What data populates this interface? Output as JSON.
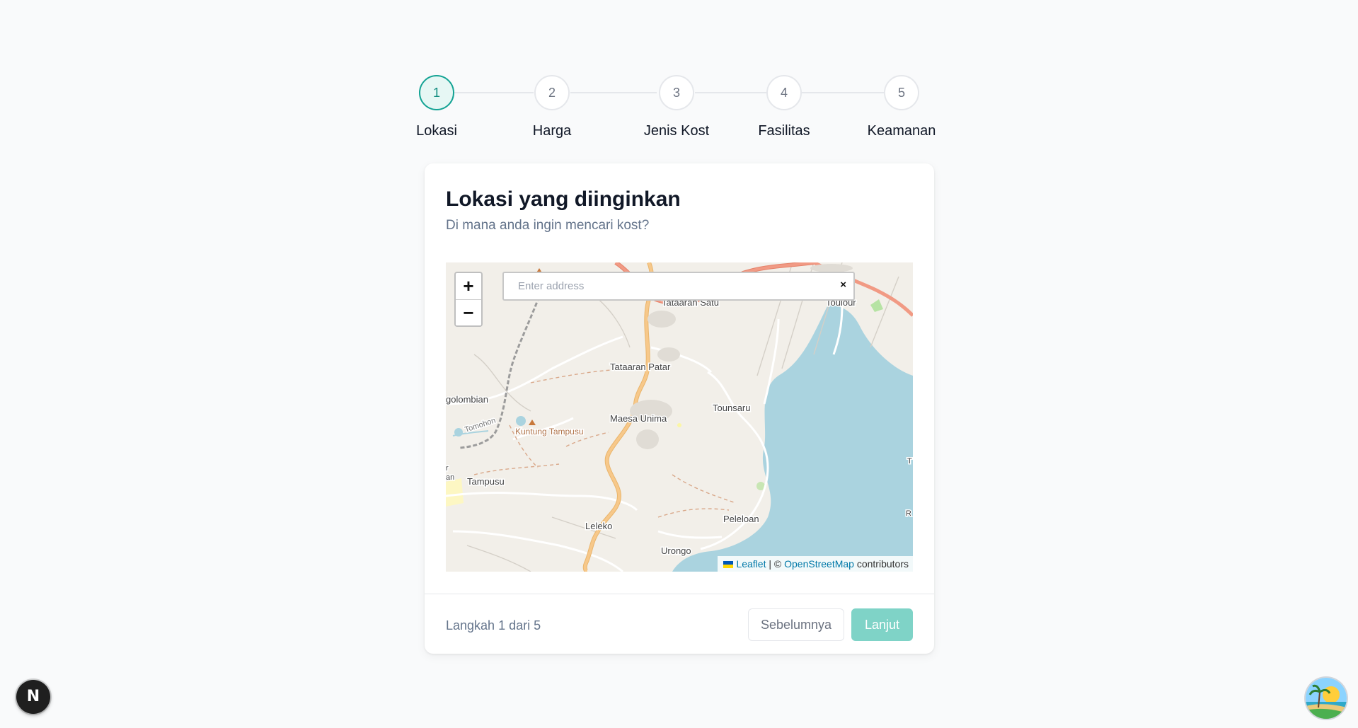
{
  "stepper": {
    "steps": [
      {
        "number": "1",
        "label": "Lokasi",
        "active": true
      },
      {
        "number": "2",
        "label": "Harga",
        "active": false
      },
      {
        "number": "3",
        "label": "Jenis Kost",
        "active": false
      },
      {
        "number": "4",
        "label": "Fasilitas",
        "active": false
      },
      {
        "number": "5",
        "label": "Keamanan",
        "active": false
      }
    ]
  },
  "card": {
    "title": "Lokasi yang diinginkan",
    "subtitle": "Di mana anda ingin mencari kost?"
  },
  "map": {
    "zoom_in": "+",
    "zoom_out": "−",
    "search_placeholder": "Enter address",
    "search_value": "",
    "clear": "×",
    "places": [
      "Tataaran Satu",
      "Toulour",
      "Tataaran Patar",
      "golombian",
      "Tomohon",
      "Kuntung Tampusu",
      "Maesa Unima",
      "Tounsaru",
      "Tampusu",
      "an",
      "r",
      "Leleko",
      "Peleloan",
      "Urongo",
      "T",
      "R"
    ],
    "attribution": {
      "leaflet": "Leaflet",
      "separator": " | © ",
      "osm": "OpenStreetMap",
      "suffix": " contributors"
    }
  },
  "footer": {
    "step_counter": "Langkah 1 dari 5",
    "prev_label": "Sebelumnya",
    "next_label": "Lanjut"
  },
  "floating": {
    "badge_letter": "N"
  },
  "colors": {
    "accent": "#14a394",
    "accent_light": "#7fd3c7",
    "water": "#aad3df",
    "land": "#f2efe9",
    "road_major": "#f7c88a",
    "road_primary": "#f19a84"
  }
}
